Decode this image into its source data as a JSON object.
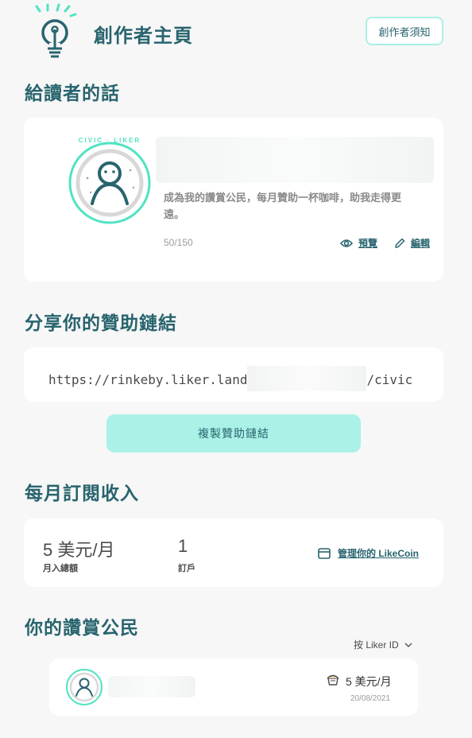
{
  "header": {
    "title": "創作者主頁",
    "guide_button": "創作者須知"
  },
  "message_section": {
    "heading": "給讀者的話",
    "avatar_badge_text": "CIVIC · LIKER",
    "message": "成為我的讚賞公民，每月贊助一杯咖啡，助我走得更遠。",
    "char_count": "50/150",
    "preview_label": "預覽",
    "edit_label": "編輯"
  },
  "share_section": {
    "heading": "分享你的贊助鏈結",
    "url_prefix": "https://rinkeby.liker.land",
    "url_suffix": "/civic",
    "copy_button": "複製贊助鏈結"
  },
  "income_section": {
    "heading": "每月訂閱收入",
    "total_amount": "5 美元/月",
    "total_label": "月入總額",
    "subscriber_count": "1",
    "subscriber_label": "訂戶",
    "manage_link": "管理你的 LikeCoin"
  },
  "supporters_section": {
    "heading": "你的讚賞公民",
    "sort_label": "按 Liker ID",
    "supporters": [
      {
        "amount": "5 美元/月",
        "date": "20/08/2021"
      }
    ]
  },
  "colors": {
    "primary_dark": "#28646e",
    "accent_mint": "#50e3c2",
    "button_mint": "#aaf1e7"
  }
}
